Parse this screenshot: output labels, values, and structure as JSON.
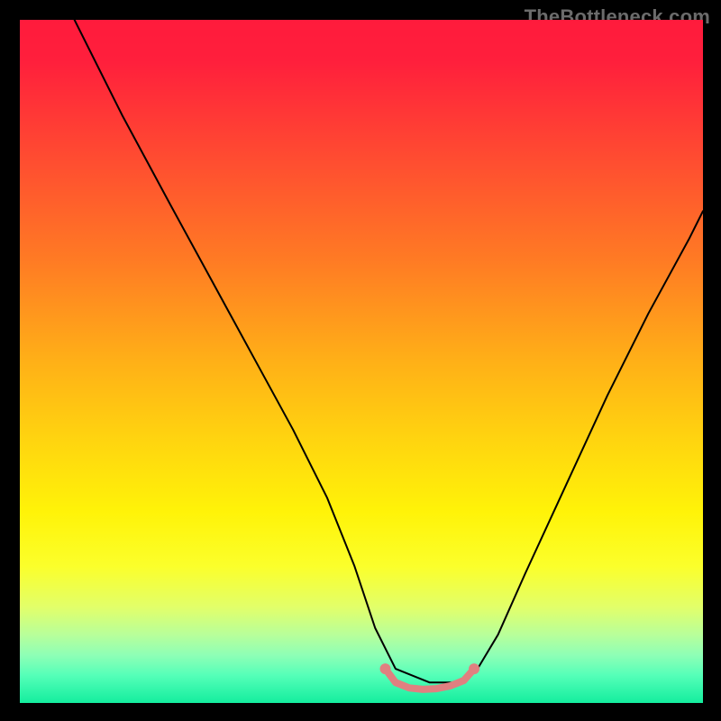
{
  "watermark": "TheBottleneck.com",
  "chart_data": {
    "type": "line",
    "title": "",
    "xlabel": "",
    "ylabel": "",
    "xlim": [
      0,
      100
    ],
    "ylim": [
      0,
      100
    ],
    "background_gradient_stops": [
      {
        "offset": 0.0,
        "color": "#ff1b3c"
      },
      {
        "offset": 0.06,
        "color": "#ff1f3c"
      },
      {
        "offset": 0.2,
        "color": "#ff4b31"
      },
      {
        "offset": 0.35,
        "color": "#ff7a24"
      },
      {
        "offset": 0.5,
        "color": "#ffb017"
      },
      {
        "offset": 0.62,
        "color": "#ffd60f"
      },
      {
        "offset": 0.72,
        "color": "#fff308"
      },
      {
        "offset": 0.8,
        "color": "#fbff2b"
      },
      {
        "offset": 0.86,
        "color": "#e2ff6a"
      },
      {
        "offset": 0.9,
        "color": "#b8ff9a"
      },
      {
        "offset": 0.93,
        "color": "#8effb6"
      },
      {
        "offset": 0.96,
        "color": "#54ffb8"
      },
      {
        "offset": 1.0,
        "color": "#14ed9e"
      }
    ],
    "series": [
      {
        "name": "bottleneck-curve",
        "stroke": "#000000",
        "stroke_width": 2,
        "x": [
          8,
          15,
          22,
          28,
          34,
          40,
          45,
          49,
          52,
          55,
          60,
          64,
          67,
          70,
          74,
          80,
          86,
          92,
          98,
          100
        ],
        "y": [
          100,
          86,
          73,
          62,
          51,
          40,
          30,
          20,
          11,
          5,
          3,
          3,
          5,
          10,
          19,
          32,
          45,
          57,
          68,
          72
        ]
      },
      {
        "name": "optimal-marker",
        "stroke": "#e08080",
        "stroke_width": 8,
        "dots": true,
        "dot_radius": 6,
        "x": [
          53.5,
          55,
          57,
          59,
          61,
          63,
          65,
          66.5
        ],
        "y": [
          5.0,
          3.0,
          2.2,
          2.0,
          2.1,
          2.5,
          3.3,
          5.0
        ]
      }
    ]
  }
}
